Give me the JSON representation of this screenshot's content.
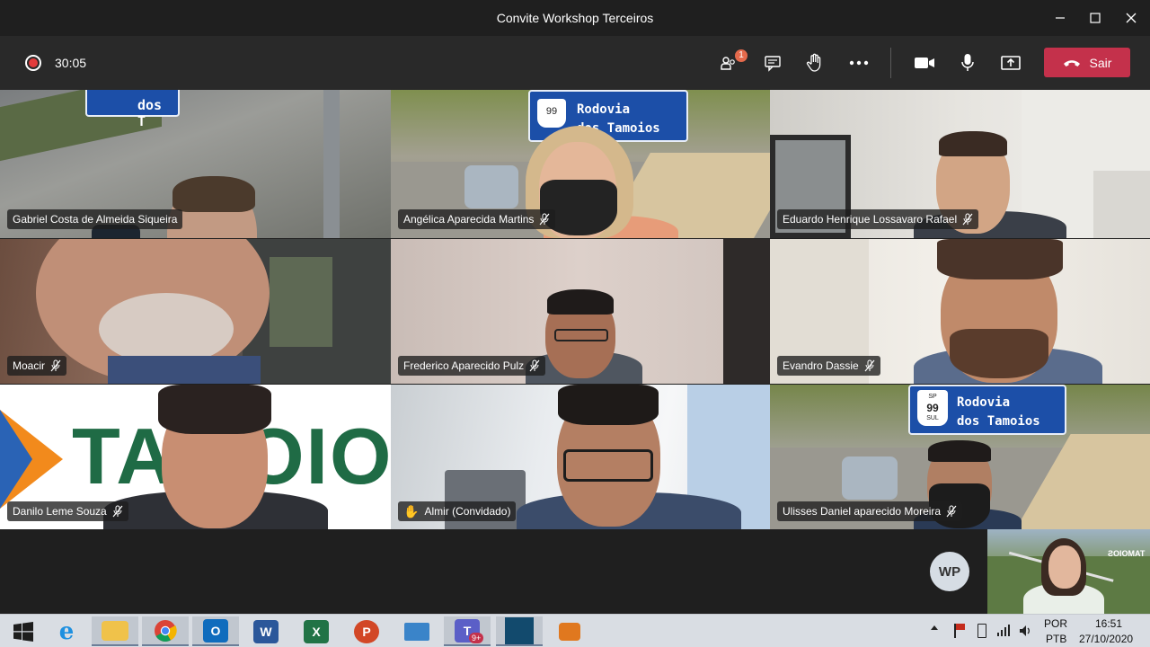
{
  "window": {
    "title": "Convite Workshop Terceiros",
    "controls": [
      "minimize-icon",
      "maximize-icon",
      "close-icon"
    ]
  },
  "toolbar": {
    "recording_time": "30:05",
    "participants_badge": "1",
    "leave_label": "Sair",
    "icons": [
      "participants-icon",
      "chat-icon",
      "raise-hand-icon",
      "more-icon",
      "camera-icon",
      "microphone-icon",
      "share-screen-icon",
      "hang-up-icon"
    ],
    "colors": {
      "leave": "#c4314b",
      "badge": "#e56a4c",
      "record": "#e23b3b"
    }
  },
  "participants": [
    {
      "name": "Gabriel Costa de Almeida Siqueira",
      "muted": false,
      "hand_raised": false
    },
    {
      "name": "Angélica Aparecida Martins",
      "muted": true,
      "hand_raised": false
    },
    {
      "name": "Eduardo Henrique Lossavaro Rafael",
      "muted": true,
      "hand_raised": false
    },
    {
      "name": "Moacir",
      "muted": true,
      "hand_raised": false
    },
    {
      "name": "Frederico Aparecido Pulz",
      "muted": true,
      "hand_raised": false
    },
    {
      "name": "Evandro Dassie",
      "muted": true,
      "hand_raised": false
    },
    {
      "name": "Danilo Leme Souza",
      "muted": true,
      "hand_raised": false
    },
    {
      "name": "Almir (Convidado)",
      "muted": false,
      "hand_raised": true
    },
    {
      "name": "Ulisses Daniel aparecido Moreira",
      "muted": true,
      "hand_raised": false
    }
  ],
  "background_signs": {
    "road_sign_line1": "Rodovia",
    "road_sign_line2": "dos Tamoios",
    "highway_number": "99",
    "highway_prefix": "SP",
    "highway_direction": "SUL",
    "partial_sign_text": "dos T",
    "brand_background_text": "TAMOIOS"
  },
  "other_participant_avatar": "WP",
  "selfview_logo": "TAMOIOS",
  "taskbar": {
    "apps": [
      "windows-start-icon",
      "internet-explorer-icon",
      "file-explorer-icon",
      "chrome-icon",
      "outlook-icon",
      "word-icon",
      "excel-icon",
      "powerpoint-icon",
      "remote-desktop-icon",
      "teams-icon",
      "app-window-icon",
      "tool-icon"
    ],
    "teams_badge": "9+",
    "language_line1": "POR",
    "language_line2": "PTB",
    "time": "16:51",
    "date": "27/10/2020"
  }
}
